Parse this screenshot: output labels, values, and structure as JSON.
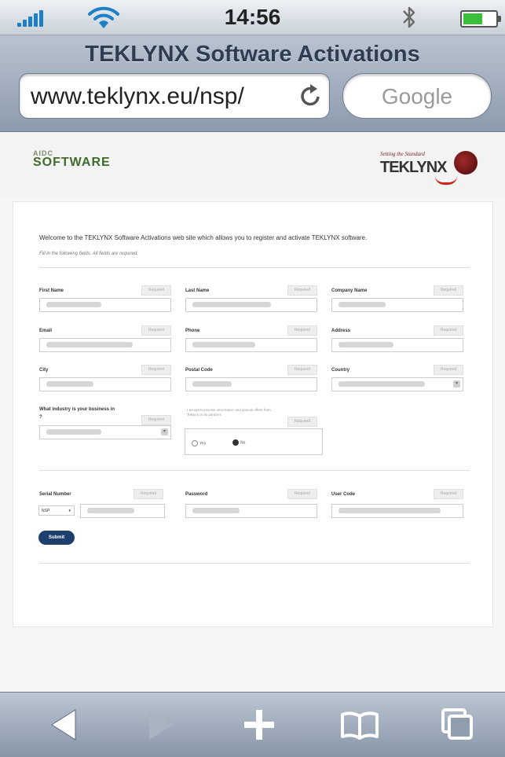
{
  "status": {
    "time": "14:56"
  },
  "browser": {
    "title": "TEKLYNX Software Activations",
    "url": "www.teklynx.eu/nsp/",
    "search_placeholder": "Google"
  },
  "header": {
    "aidc_small": "AIDC",
    "aidc_big": "SOFTWARE",
    "teklynx_tagline": "Setting the Standard",
    "teklynx_word": "TEKLYNX"
  },
  "form": {
    "welcome": "Welcome to the TEKLYNX Software Activations web site which allows you to register and activate TEKLYNX software.",
    "instructions": "Fill in the following fields. All fields are required.",
    "required_label": "Required",
    "fields": {
      "first_name": "First Name",
      "last_name": "Last Name",
      "company_name": "Company Name",
      "email": "Email",
      "phone": "Phone",
      "address": "Address",
      "city": "City",
      "postal_code": "Postal Code",
      "country": "Country",
      "industry": "What industry is your business in ?",
      "serial_number": "Serial Number",
      "password": "Password",
      "user_code": "User Code"
    },
    "consent_text": "I accept to receive information and special offers from Teklynx or its partners",
    "radio_yes": "Yes",
    "radio_no": "No",
    "serial_prefix": "NSP",
    "submit": "Submit"
  }
}
